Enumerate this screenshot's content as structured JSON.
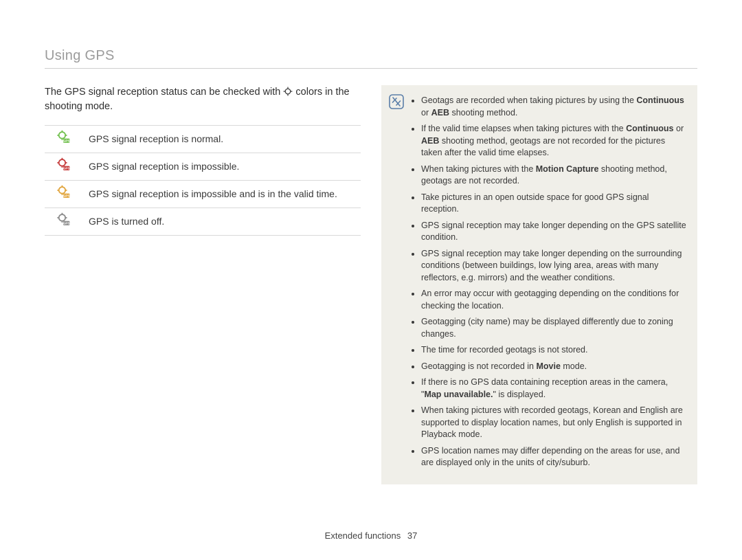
{
  "header": {
    "title": "Using GPS"
  },
  "intro": {
    "pre": "The GPS signal reception status can be checked with ",
    "post": " colors in the shooting mode."
  },
  "status_rows": [
    {
      "icon": "gps-normal-icon",
      "fill": "#6fbf4b",
      "text": "GPS signal reception is normal."
    },
    {
      "icon": "gps-impossible-icon",
      "fill": "#c53a3a",
      "text": "GPS signal reception is impossible."
    },
    {
      "icon": "gps-valid-icon",
      "fill": "#e0a33a",
      "text": "GPS signal reception is impossible and is in the valid time."
    },
    {
      "icon": "gps-off-icon",
      "fill": "#8a8a8a",
      "text": "GPS is turned off."
    }
  ],
  "notes": [
    {
      "runs": [
        {
          "t": "Geotags are recorded when taking pictures by using the "
        },
        {
          "t": "Continuous",
          "b": true
        },
        {
          "t": " or "
        },
        {
          "t": "AEB",
          "b": true
        },
        {
          "t": " shooting method."
        }
      ]
    },
    {
      "runs": [
        {
          "t": "If the valid time elapses when taking pictures with the "
        },
        {
          "t": "Continuous",
          "b": true
        },
        {
          "t": " or "
        },
        {
          "t": "AEB",
          "b": true
        },
        {
          "t": " shooting method, geotags are not recorded for the pictures taken after the valid time elapses."
        }
      ]
    },
    {
      "runs": [
        {
          "t": "When taking pictures with the "
        },
        {
          "t": "Motion Capture",
          "b": true
        },
        {
          "t": " shooting method, geotags are not recorded."
        }
      ]
    },
    {
      "runs": [
        {
          "t": "Take pictures in an open outside space for good GPS signal reception."
        }
      ]
    },
    {
      "runs": [
        {
          "t": "GPS signal reception may take longer depending on the GPS satellite condition."
        }
      ]
    },
    {
      "runs": [
        {
          "t": "GPS signal reception may take longer depending on the surrounding conditions (between buildings, low lying area, areas with many reflectors, e.g. mirrors) and the weather conditions."
        }
      ]
    },
    {
      "runs": [
        {
          "t": "An error may occur with geotagging depending on the conditions for checking the location."
        }
      ]
    },
    {
      "runs": [
        {
          "t": "Geotagging (city name) may be displayed differently due to zoning changes."
        }
      ]
    },
    {
      "runs": [
        {
          "t": "The time for recorded geotags is not stored."
        }
      ]
    },
    {
      "runs": [
        {
          "t": "Geotagging is not recorded in "
        },
        {
          "t": "Movie",
          "b": true
        },
        {
          "t": " mode."
        }
      ]
    },
    {
      "runs": [
        {
          "t": "If there is no GPS data containing reception areas in the camera, \""
        },
        {
          "t": "Map unavailable.",
          "b": true
        },
        {
          "t": "\" is displayed."
        }
      ]
    },
    {
      "runs": [
        {
          "t": "When taking pictures with recorded geotags, Korean and English are supported to display location names, but only English is supported in Playback mode."
        }
      ]
    },
    {
      "runs": [
        {
          "t": "GPS location names may differ depending on the areas for use, and are displayed only in the units of city/suburb."
        }
      ]
    }
  ],
  "footer": {
    "section": "Extended functions",
    "page": "37"
  }
}
